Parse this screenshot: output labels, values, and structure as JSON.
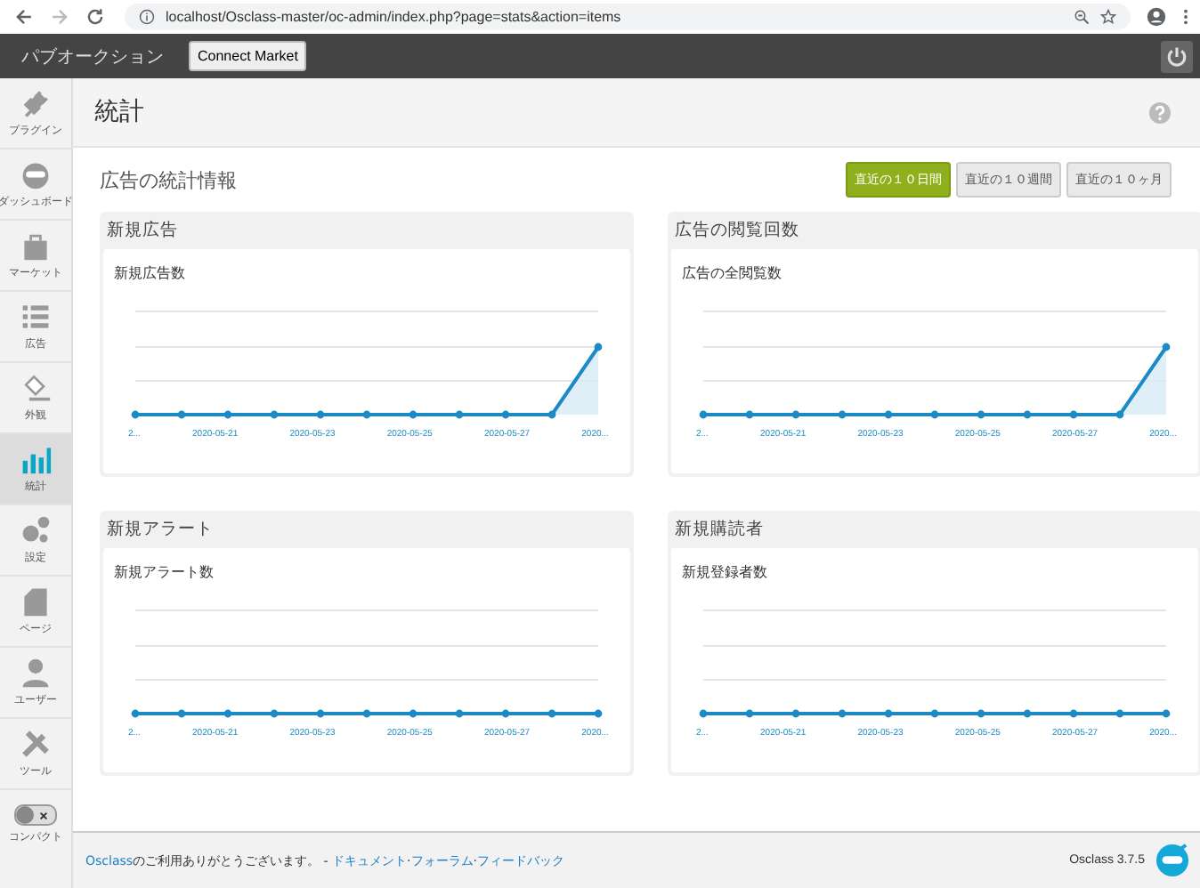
{
  "browser": {
    "url": "localhost/Osclass-master/oc-admin/index.php?page=stats&action=items"
  },
  "topbar": {
    "site_title": "パブオークション",
    "market_button": "Connect Market"
  },
  "sidebar": {
    "items": [
      {
        "label": "プラグイン",
        "selected": false
      },
      {
        "label": "ダッシュボード",
        "selected": false
      },
      {
        "label": "マーケット",
        "selected": false
      },
      {
        "label": "広告",
        "selected": false
      },
      {
        "label": "外観",
        "selected": false
      },
      {
        "label": "統計",
        "selected": true
      },
      {
        "label": "設定",
        "selected": false
      },
      {
        "label": "ページ",
        "selected": false
      },
      {
        "label": "ユーザー",
        "selected": false
      },
      {
        "label": "ツール",
        "selected": false
      }
    ],
    "compact": {
      "label": "コンパクト",
      "on": false
    }
  },
  "page": {
    "title": "統計",
    "section_title": "広告の統計情報",
    "ranges": [
      {
        "label": "直近の１０日間",
        "selected": true
      },
      {
        "label": "直近の１０週間",
        "selected": false
      },
      {
        "label": "直近の１０ヶ月",
        "selected": false
      }
    ]
  },
  "cards": [
    {
      "title": "新規広告",
      "chart_title": "新規広告数",
      "kind": "rising",
      "x_labels": [
        "2...",
        "2020-05-21",
        "2020-05-23",
        "2020-05-25",
        "2020-05-27",
        "2020..."
      ]
    },
    {
      "title": "広告の閲覧回数",
      "chart_title": "広告の全閲覧数",
      "kind": "rising",
      "x_labels": [
        "2...",
        "2020-05-21",
        "2020-05-23",
        "2020-05-25",
        "2020-05-27",
        "2020..."
      ]
    },
    {
      "title": "新規アラート",
      "chart_title": "新規アラート数",
      "kind": "flat",
      "x_labels": [
        "2...",
        "2020-05-21",
        "2020-05-23",
        "2020-05-25",
        "2020-05-27",
        "2020..."
      ]
    },
    {
      "title": "新規購読者",
      "chart_title": "新規登録者数",
      "kind": "flat",
      "x_labels": [
        "2...",
        "2020-05-21",
        "2020-05-23",
        "2020-05-25",
        "2020-05-27",
        "2020..."
      ]
    }
  ],
  "footer": {
    "brand_link": "Osclass",
    "thanks": "のご利用ありがとうございます。 -",
    "separator": "·",
    "links": [
      "ドキュメント",
      "フォーラム",
      "フィードバック"
    ],
    "version": "Osclass 3.7.5"
  }
}
